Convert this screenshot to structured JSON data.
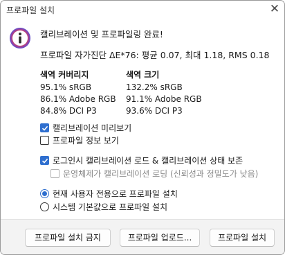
{
  "window": {
    "title": "프로파일 설치",
    "close_glyph": "✕"
  },
  "heading": "캘리브레이션 및 프로파일링 완료!",
  "summary": "프로파일 자가진단 ΔE*76: 평균 0.07, 최대 1.18, RMS 0.18",
  "gamut_coverage": {
    "header": "색역 커버리지",
    "rows": [
      "95.1% sRGB",
      "86.1% Adobe RGB",
      "84.8% DCI P3"
    ]
  },
  "gamut_volume": {
    "header": "색역 크기",
    "rows": [
      "132.2% sRGB",
      "91.1% Adobe RGB",
      "93.6% DCI P3"
    ]
  },
  "options": {
    "preview_calibration": {
      "label": "캘리브레이션 미리보기",
      "checked": true
    },
    "show_profile_info": {
      "label": "프로파일 정보 보기",
      "checked": false
    },
    "load_on_login": {
      "label": "로그인시 캘리브레이션 로드 & 캘리브레이션 상태 보존",
      "checked": true
    },
    "os_load": {
      "label": "운영체제가 캘리브레이션 로딩 (신뢰성과 정밀도가 낮음)",
      "checked": false,
      "disabled": true
    }
  },
  "install_scope": {
    "current_user": {
      "label": "현재 사용자 전용으로 프로파일 설치",
      "selected": true
    },
    "system_default": {
      "label": "시스템 기본값으로 프로파일 설치",
      "selected": false
    }
  },
  "buttons": {
    "no_install": "프로파일 설치 금지",
    "upload": "프로파일 업로드...",
    "install": "프로파일 설치"
  },
  "colors": {
    "accent": "#2f6fcf",
    "info_icon_ring": "#8a3fa8",
    "info_icon_fill": "#f4d34a"
  },
  "icons": {
    "info": "info-icon",
    "close": "close-icon",
    "check": "checkmark-icon"
  }
}
